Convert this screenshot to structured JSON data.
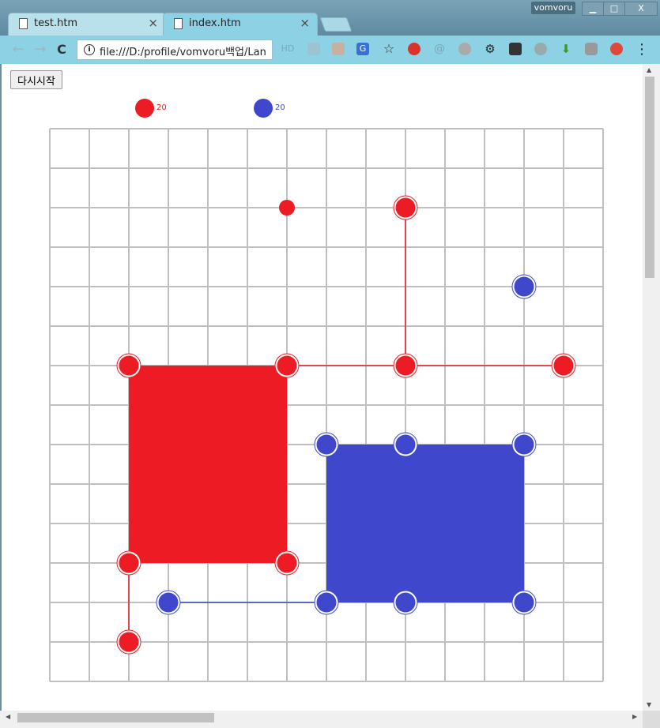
{
  "window": {
    "user": "vomvoru",
    "minimize": "▁",
    "maximize": "□",
    "close": "X"
  },
  "tabs": [
    {
      "label": "test.htm",
      "close": "×"
    },
    {
      "label": "index.htm",
      "close": "×"
    }
  ],
  "toolbar": {
    "back": "←",
    "forward": "→",
    "reload": "C",
    "url": "file:///D:/profile/vomvoru백업/Lan",
    "menu": "⋮"
  },
  "game": {
    "restart_label": "다시시작",
    "red_score": "20",
    "blue_score": "20",
    "colors": {
      "red": "#ed1c24",
      "blue": "#3f48cc",
      "grid": "#c0c0c0"
    },
    "grid_size": 14,
    "red_box": {
      "from": [
        2,
        6
      ],
      "to": [
        6,
        11
      ]
    },
    "blue_box": {
      "from": [
        7,
        8
      ],
      "to": [
        12,
        12
      ]
    },
    "red_points": [
      [
        2,
        6
      ],
      [
        6,
        6
      ],
      [
        9,
        6
      ],
      [
        13,
        6
      ],
      [
        9,
        2
      ],
      [
        2,
        11
      ],
      [
        6,
        11
      ],
      [
        2,
        13
      ]
    ],
    "red_small_points": [
      [
        6,
        2
      ]
    ],
    "blue_points": [
      [
        12,
        4
      ],
      [
        7,
        8
      ],
      [
        9,
        8
      ],
      [
        12,
        8
      ],
      [
        3,
        12
      ],
      [
        7,
        12
      ],
      [
        9,
        12
      ],
      [
        12,
        12
      ]
    ],
    "red_lines": [
      [
        [
          6,
          6
        ],
        [
          13,
          6
        ]
      ],
      [
        [
          9,
          2
        ],
        [
          9,
          6
        ]
      ],
      [
        [
          2,
          11
        ],
        [
          2,
          13
        ]
      ]
    ],
    "blue_lines": [
      [
        [
          3,
          12
        ],
        [
          7,
          12
        ]
      ]
    ]
  }
}
